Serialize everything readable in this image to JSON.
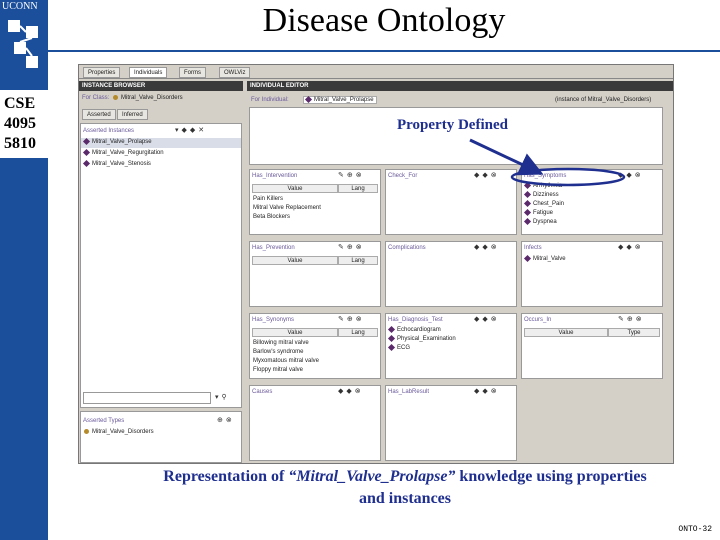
{
  "brand": {
    "name": "UCONN"
  },
  "course": [
    "CSE",
    "4095",
    "5810"
  ],
  "title": "Disease Ontology",
  "annotation": "Property Defined",
  "caption": {
    "prefix": "Representation of",
    "quoted": "“Mitral_Valve_Prolapse”",
    "suffix_line1": "knowledge using properties",
    "line2": "and instances"
  },
  "footer": "ONTO-32",
  "app": {
    "tabs": [
      "Properties",
      "Individuals",
      "Forms",
      "OWLViz"
    ],
    "instance_browser": {
      "header": "INSTANCE BROWSER",
      "for_class_label": "For Class:",
      "for_class_value": "Mitral_Valve_Disorders",
      "subtabs": [
        "Asserted",
        "Inferred"
      ],
      "asserted_label": "Asserted Instances",
      "instances": [
        "Mitral_Valve_Prolapse",
        "Mitral_Valve_Regurgitation",
        "Mitral_Valve_Stenosis"
      ],
      "asserted_types_label": "Asserted Types",
      "asserted_types": [
        "Mitral_Valve_Disorders"
      ]
    },
    "individual_editor": {
      "header": "INDIVIDUAL EDITOR",
      "for_individual_label": "For Individual:",
      "for_individual_value": "Mitral_Valve_Prolapse",
      "instance_of": "(instance of Mitral_Valve_Disorders)",
      "has_intervention": {
        "label": "Has_Intervention",
        "cols": [
          "Value",
          "Lang"
        ],
        "rows": [
          "Pain Killers",
          "Mitral Valve Replacement",
          "Beta Blockers"
        ]
      },
      "check_for": {
        "label": "Check_For"
      },
      "has_symptoms": {
        "label": "Has_Symptoms",
        "items": [
          "Arrhythmia",
          "Dizziness",
          "Chest_Pain",
          "Fatigue",
          "Dyspnea"
        ]
      },
      "has_prevention": {
        "label": "Has_Prevention",
        "cols": [
          "Value",
          "Lang"
        ]
      },
      "complications": {
        "label": "Complications"
      },
      "infects": {
        "label": "Infects",
        "items": [
          "Mitral_Valve"
        ]
      },
      "has_synonyms": {
        "label": "Has_Synonyms",
        "cols": [
          "Value",
          "Lang"
        ],
        "rows": [
          "Billowing mitral valve",
          "Barlow's syndrome",
          "Myxomatous mitral valve",
          "Floppy mitral valve"
        ]
      },
      "has_diagnosis_test": {
        "label": "Has_Diagnosis_Test",
        "items": [
          "Echocardiogram",
          "Physical_Examination",
          "ECG"
        ]
      },
      "occurs_in": {
        "label": "Occurs_In",
        "cols": [
          "Value",
          "Type"
        ]
      },
      "causes": {
        "label": "Causes"
      },
      "has_labresult": {
        "label": "Has_LabResult"
      }
    }
  },
  "colors": {
    "brand_blue": "#1b4f9c",
    "annotation_blue": "#1f2f8f",
    "header_dark": "#3a3a3a"
  }
}
